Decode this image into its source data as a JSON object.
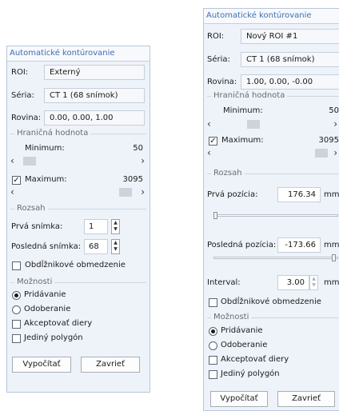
{
  "left": {
    "title": "Automatické kontúrovanie",
    "roi_label": "ROI:",
    "roi_value": "Externý",
    "seria_label": "Séria:",
    "seria_value": "CT 1 (68 snímok)",
    "rovina_label": "Rovina:",
    "rovina_value": "0.00, 0.00, 1.00",
    "hranicna_title": "Hraničná hodnota",
    "minimum_label": "Minimum:",
    "minimum_value": "50",
    "maximum_label": "Maximum:",
    "maximum_value": "3095",
    "maximum_checked": true,
    "rozsah_title": "Rozsah",
    "prva_label": "Prvá snímka:",
    "prva_value": "1",
    "posledna_label": "Posledná snímka:",
    "posledna_value": "68",
    "obdlz_label": "Obdĺžnikové obmedzenie",
    "moznosti_title": "Možnosti",
    "pridavanie_label": "Pridávanie",
    "odoberanie_label": "Odoberanie",
    "akcept_label": "Akceptovať diery",
    "jediny_label": "Jediný polygón",
    "vypocitat_label": "Vypočítať",
    "zavriet_label": "Zavrieť"
  },
  "right": {
    "title": "Automatické kontúrovanie",
    "roi_label": "ROI:",
    "roi_value": "Nový ROI #1",
    "seria_label": "Séria:",
    "seria_value": "CT 1 (68 snímok)",
    "rovina_label": "Rovina:",
    "rovina_value": "1.00, 0.00, -0.00",
    "hranicna_title": "Hraničná hodnota",
    "minimum_label": "Minimum:",
    "minimum_value": "50",
    "maximum_label": "Maximum:",
    "maximum_value": "3095",
    "maximum_checked": true,
    "rozsah_title": "Rozsah",
    "prva_label": "Prvá pozícia:",
    "prva_value": "176.34",
    "prva_unit": "mm",
    "posledna_label": "Posledná pozícia:",
    "posledna_value": "-173.66",
    "posledna_unit": "mm",
    "interval_label": "Interval:",
    "interval_value": "3.00",
    "interval_unit": "mm",
    "obdlz_label": "Obdĺžnikové obmedzenie",
    "moznosti_title": "Možnosti",
    "pridavanie_label": "Pridávanie",
    "odoberanie_label": "Odoberanie",
    "akcept_label": "Akceptovať diery",
    "jediny_label": "Jediný polygón",
    "vypocitat_label": "Vypočítať",
    "zavriet_label": "Zavrieť"
  },
  "icons": {
    "arrow_left": "‹",
    "arrow_right": "›",
    "check": "✓",
    "spin_up": "▲",
    "spin_down": "▼"
  }
}
